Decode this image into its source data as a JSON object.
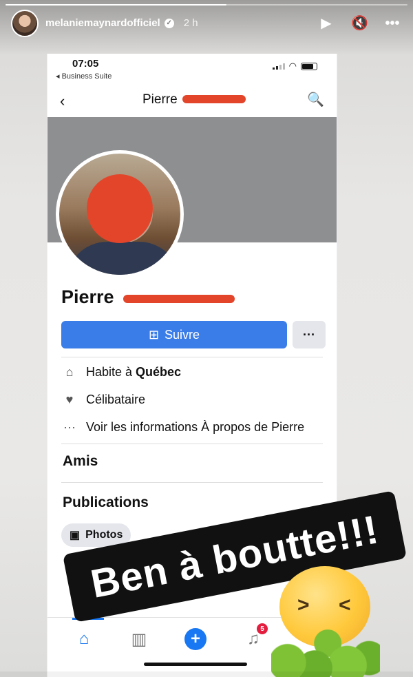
{
  "story": {
    "username": "melaniemaynardofficiel",
    "time_ago": "2 h",
    "icons": {
      "play": "play-icon",
      "mute": "speaker-muted-icon",
      "more": "more-horizontal-icon",
      "verified": "verified-badge-icon"
    },
    "sticker_text": "Ben à boutte!!!",
    "emoji": "vomiting-face-emoji"
  },
  "phone": {
    "status": {
      "time": "07:05",
      "back_app": "◂ Business Suite"
    },
    "nav": {
      "title": "Pierre"
    },
    "profile": {
      "name": "Pierre",
      "follow_label": "Suivre",
      "more_label": "···",
      "info": [
        {
          "icon": "house-icon",
          "text_prefix": "Habite à ",
          "text_bold": "Québec"
        },
        {
          "icon": "heart-icon",
          "text": "Célibataire"
        },
        {
          "icon": "dots-icon",
          "text": "Voir les informations À propos de Pierre"
        }
      ],
      "friends_title": "Amis",
      "posts_title": "Publications",
      "photos_chip": "Photos"
    },
    "bottom_tabs": [
      {
        "icon": "home-icon",
        "active": true
      },
      {
        "icon": "insights-icon"
      },
      {
        "icon": "create-plus-icon"
      },
      {
        "icon": "notifications-bell-icon",
        "badge": "5"
      }
    ]
  },
  "colors": {
    "accent": "#3b7de8",
    "redaction": "#e3452b",
    "notif_badge": "#e41e3f"
  }
}
